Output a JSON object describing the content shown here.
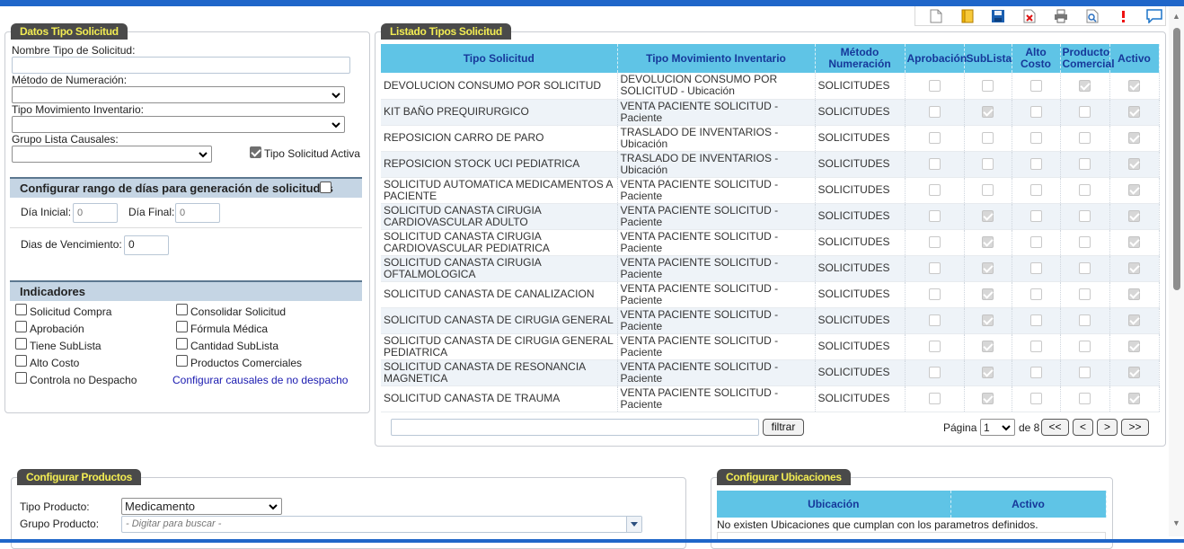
{
  "toolbar": {
    "icons": [
      "new-document-icon",
      "bookmark-icon",
      "save-icon",
      "delete-icon",
      "print-icon",
      "preview-icon",
      "alert-icon",
      "chat-icon"
    ]
  },
  "datos": {
    "title": "Datos Tipo Solicitud",
    "nombre_label": "Nombre Tipo de Solicitud:",
    "nombre_value": "",
    "metodo_label": "Método de Numeración:",
    "metodo_value": "",
    "tipo_mov_label": "Tipo Movimiento Inventario:",
    "tipo_mov_value": "",
    "grupo_label": "Grupo Lista Causales:",
    "grupo_value": "",
    "activa_label": "Tipo Solicitud Activa",
    "activa_checked": true,
    "rango_title": "Configurar rango de días para generación de solicitudes",
    "rango_checked": false,
    "dia_inicial_label": "Día Inicial:",
    "dia_inicial_placeholder": "0",
    "dia_final_label": "Día Final:",
    "dia_final_placeholder": "0",
    "vencimiento_label": "Dias de Vencimiento:",
    "vencimiento_value": "0",
    "indicadores_title": "Indicadores",
    "indicadores_left": [
      {
        "label": "Solicitud Compra",
        "checked": false
      },
      {
        "label": "Aprobación",
        "checked": false
      },
      {
        "label": "Tiene SubLista",
        "checked": false
      },
      {
        "label": "Alto Costo",
        "checked": false
      },
      {
        "label": "Controla no Despacho",
        "checked": false
      }
    ],
    "indicadores_right": [
      {
        "label": "Consolidar Solicitud",
        "checked": false
      },
      {
        "label": "Fórmula Médica",
        "checked": false
      },
      {
        "label": "Cantidad SubLista",
        "checked": false
      },
      {
        "label": "Productos Comerciales",
        "checked": false
      }
    ],
    "causales_link": "Configurar causales de no despacho"
  },
  "listado": {
    "title": "Listado Tipos Solicitud",
    "columns": [
      "Tipo Solicitud",
      "Tipo Movimiento Inventario",
      "Método Numeración",
      "Aprobación",
      "SubLista",
      "Alto Costo",
      "Producto Comercial",
      "Activo"
    ],
    "rows": [
      {
        "tipo": "DEVOLUCION CONSUMO POR SOLICITUD",
        "mov": "DEVOLUCION CONSUMO POR SOLICITUD - Ubicación",
        "metodo": "SOLICITUDES",
        "aprobacion": false,
        "sublista": false,
        "alto_costo": false,
        "producto": true,
        "activo": true
      },
      {
        "tipo": "KIT BAÑO PREQUIRURGICO",
        "mov": "VENTA PACIENTE SOLICITUD - Paciente",
        "metodo": "SOLICITUDES",
        "aprobacion": false,
        "sublista": true,
        "alto_costo": false,
        "producto": false,
        "activo": true
      },
      {
        "tipo": "REPOSICION CARRO DE PARO",
        "mov": "TRASLADO DE INVENTARIOS - Ubicación",
        "metodo": "SOLICITUDES",
        "aprobacion": false,
        "sublista": false,
        "alto_costo": false,
        "producto": false,
        "activo": true
      },
      {
        "tipo": "REPOSICION STOCK UCI PEDIATRICA",
        "mov": "TRASLADO DE INVENTARIOS - Ubicación",
        "metodo": "SOLICITUDES",
        "aprobacion": false,
        "sublista": false,
        "alto_costo": false,
        "producto": false,
        "activo": true
      },
      {
        "tipo": "SOLICITUD AUTOMATICA MEDICAMENTOS A PACIENTE",
        "mov": "VENTA PACIENTE SOLICITUD - Paciente",
        "metodo": "SOLICITUDES",
        "aprobacion": false,
        "sublista": false,
        "alto_costo": false,
        "producto": false,
        "activo": true
      },
      {
        "tipo": "SOLICITUD CANASTA CIRUGIA CARDIOVASCULAR ADULTO",
        "mov": "VENTA PACIENTE SOLICITUD - Paciente",
        "metodo": "SOLICITUDES",
        "aprobacion": false,
        "sublista": true,
        "alto_costo": false,
        "producto": false,
        "activo": true
      },
      {
        "tipo": "SOLICITUD CANASTA CIRUGIA CARDIOVASCULAR PEDIATRICA",
        "mov": "VENTA PACIENTE SOLICITUD - Paciente",
        "metodo": "SOLICITUDES",
        "aprobacion": false,
        "sublista": true,
        "alto_costo": false,
        "producto": false,
        "activo": true
      },
      {
        "tipo": "SOLICITUD CANASTA CIRUGIA OFTALMOLOGICA",
        "mov": "VENTA PACIENTE SOLICITUD - Paciente",
        "metodo": "SOLICITUDES",
        "aprobacion": false,
        "sublista": true,
        "alto_costo": false,
        "producto": false,
        "activo": true
      },
      {
        "tipo": "SOLICITUD CANASTA DE CANALIZACION",
        "mov": "VENTA PACIENTE SOLICITUD - Paciente",
        "metodo": "SOLICITUDES",
        "aprobacion": false,
        "sublista": true,
        "alto_costo": false,
        "producto": false,
        "activo": true
      },
      {
        "tipo": "SOLICITUD CANASTA DE CIRUGIA GENERAL",
        "mov": "VENTA PACIENTE SOLICITUD - Paciente",
        "metodo": "SOLICITUDES",
        "aprobacion": false,
        "sublista": true,
        "alto_costo": false,
        "producto": false,
        "activo": true
      },
      {
        "tipo": "SOLICITUD CANASTA DE CIRUGIA GENERAL PEDIATRICA",
        "mov": "VENTA PACIENTE SOLICITUD - Paciente",
        "metodo": "SOLICITUDES",
        "aprobacion": false,
        "sublista": true,
        "alto_costo": false,
        "producto": false,
        "activo": true
      },
      {
        "tipo": "SOLICITUD CANASTA DE RESONANCIA MAGNETICA",
        "mov": "VENTA PACIENTE SOLICITUD - Paciente",
        "metodo": "SOLICITUDES",
        "aprobacion": false,
        "sublista": true,
        "alto_costo": false,
        "producto": false,
        "activo": true
      },
      {
        "tipo": "SOLICITUD CANASTA DE TRAUMA",
        "mov": "VENTA PACIENTE SOLICITUD - Paciente",
        "metodo": "SOLICITUDES",
        "aprobacion": false,
        "sublista": true,
        "alto_costo": false,
        "producto": false,
        "activo": true
      }
    ],
    "filter_value": "",
    "filter_button": "filtrar",
    "pagina_label": "Página",
    "pagina_value": "1",
    "de_label": "de 8",
    "first": "<<",
    "prev": "<",
    "next": ">",
    "last": ">>"
  },
  "productos": {
    "title": "Configurar Productos",
    "tipo_label": "Tipo Producto:",
    "tipo_value": "Medicamento",
    "grupo_label": "Grupo Producto:",
    "grupo_placeholder": "- Digitar para buscar -"
  },
  "ubicaciones": {
    "title": "Configurar Ubicaciones",
    "columns": [
      "Ubicación",
      "Activo"
    ],
    "empty_message": "No existen Ubicaciones que cumplan con los parametros definidos."
  },
  "colors": {
    "topbar": "#1f66c9",
    "grid_header": "#5fc4e6",
    "grid_header_text": "#16389a",
    "panel_title_bg": "#4a4a4a",
    "panel_title_text": "#f2ec53",
    "section_head": "#c5d5e4"
  }
}
